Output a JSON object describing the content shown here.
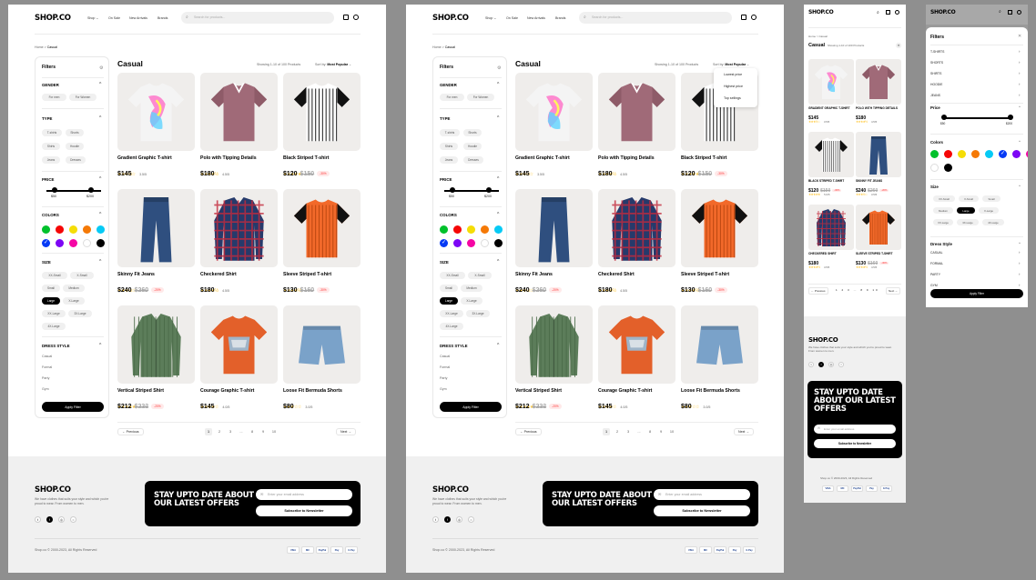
{
  "brand": "SHOP.CO",
  "nav": {
    "shop": "Shop",
    "on_sale": "On Sale",
    "new_arrivals": "New Arrivals",
    "brands": "Brands"
  },
  "search": {
    "placeholder": "Search for products..."
  },
  "breadcrumb": {
    "home": "Home",
    "current": "Casual"
  },
  "page_title": "Casual",
  "showing": "Showing 1-10 of 100 Products",
  "sort": {
    "label": "Sort by:",
    "value": "Most Popular",
    "options": [
      "Lowest price",
      "Highest price",
      "Top sellings"
    ]
  },
  "filters": {
    "title": "Filters",
    "gender": {
      "title": "GENDER",
      "options": [
        "For men",
        "For Women"
      ]
    },
    "type": {
      "title": "TYPE",
      "options": [
        "T-shirts",
        "Shorts",
        "Shirts",
        "Hoodie",
        "Jeans",
        "Dresses"
      ]
    },
    "price": {
      "title": "PRICE",
      "min": "$50",
      "max": "$200"
    },
    "colors": {
      "title": "COLORS",
      "values": [
        "#00c12b",
        "#f50606",
        "#f5dd06",
        "#f57906",
        "#06caf5",
        "#063af5",
        "#7d06f5",
        "#f506a4",
        "#ffffff",
        "#000000"
      ]
    },
    "size": {
      "title": "SIZE",
      "options": [
        "XX-Small",
        "X-Small",
        "Small",
        "Medium",
        "Large",
        "X-Large",
        "XX-Large",
        "3X-Large",
        "4X-Large"
      ],
      "selected": "Large"
    },
    "dress_style": {
      "title": "DRESS STYLE",
      "options": [
        "Casual",
        "Formal",
        "Party",
        "Gym"
      ]
    },
    "apply": "Apply Filter"
  },
  "products": [
    {
      "name": "Gradient Graphic T-shirt",
      "rating": "3.5/5",
      "stars": "★★★½☆",
      "price": "$145",
      "old": "",
      "discount": ""
    },
    {
      "name": "Polo with Tipping Details",
      "rating": "4.5/5",
      "stars": "★★★★½",
      "price": "$180",
      "old": "",
      "discount": ""
    },
    {
      "name": "Black Striped T-shirt",
      "rating": "5.0/5",
      "stars": "★★★★★",
      "price": "$120",
      "old": "$150",
      "discount": "-30%"
    },
    {
      "name": "Skinny Fit Jeans",
      "rating": "3.5/5",
      "stars": "★★★½☆",
      "price": "$240",
      "old": "$260",
      "discount": "-20%"
    },
    {
      "name": "Checkered Shirt",
      "rating": "4.5/5",
      "stars": "★★★★½",
      "price": "$180",
      "old": "",
      "discount": ""
    },
    {
      "name": "Sleeve Striped T-shirt",
      "rating": "4.5/5",
      "stars": "★★★★½",
      "price": "$130",
      "old": "$160",
      "discount": "-30%"
    },
    {
      "name": "Vertical Striped Shirt",
      "rating": "5.0/5",
      "stars": "★★★★★",
      "price": "$212",
      "old": "$232",
      "discount": "-20%"
    },
    {
      "name": "Courage Graphic T-shirt",
      "rating": "4.0/5",
      "stars": "★★★★☆",
      "price": "$145",
      "old": "",
      "discount": ""
    },
    {
      "name": "Loose Fit Bermuda Shorts",
      "rating": "3.0/5",
      "stars": "★★★☆☆",
      "price": "$80",
      "old": "",
      "discount": ""
    }
  ],
  "pagination": {
    "prev": "Previous",
    "next": "Next",
    "pages": [
      "1",
      "2",
      "3",
      "...",
      "8",
      "9",
      "10"
    ]
  },
  "footer": {
    "tagline": "We have clothes that suits your style and which you're proud to wear. From women to men.",
    "newsletter_title": "STAY UPTO DATE ABOUT OUR LATEST OFFERS",
    "email_placeholder": "Enter your email address",
    "subscribe": "Subscribe to Newsletter",
    "copyright": "Shop.co © 2000-2023, All Rights Reserved",
    "payments": [
      "VISA",
      "MC",
      "PayPal",
      "Pay",
      "G Pay"
    ]
  },
  "mobile": {
    "filter_categories": [
      "T-SHIRTS",
      "SHORTS",
      "SHIRTS",
      "HOODIE",
      "JEANS"
    ],
    "price_title": "Price",
    "colors_title": "Colors",
    "size_title": "Size",
    "dress_title": "Dress Style",
    "dress_styles": [
      "CASUAL",
      "FORMAL",
      "PARTY",
      "GYM"
    ],
    "mobile_names": [
      "GRADIENT GRAPHIC T-SHIRT",
      "POLO WITH TIPPING DETAILS",
      "BLACK STRIPED T-SHIRT",
      "SKINNY FIT JEANS",
      "CHECKERED SHIRT",
      "SLEEVE STRIPED T-SHIRT"
    ],
    "showing": "Showing 1-10 of 100 Products"
  }
}
